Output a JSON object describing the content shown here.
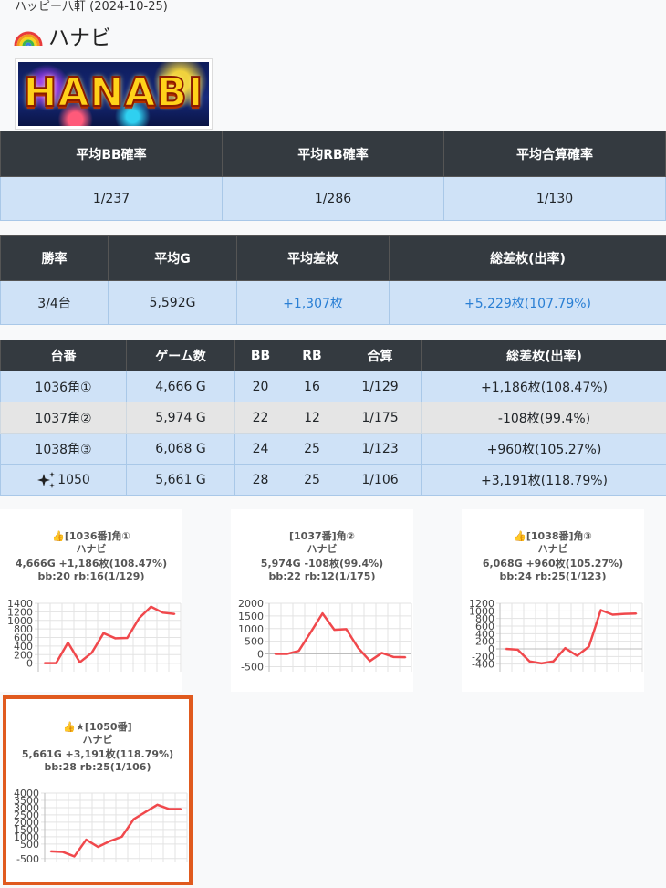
{
  "header": {
    "store_date": "ハッピー八軒 (2024-10-25)",
    "title": "ハナビ",
    "banner_text": "HANABI"
  },
  "summary1": {
    "headers": [
      "平均BB確率",
      "平均RB確率",
      "平均合算確率"
    ],
    "values": [
      "1/237",
      "1/286",
      "1/130"
    ]
  },
  "summary2": {
    "headers": [
      "勝率",
      "平均G",
      "平均差枚",
      "総差枚(出率)"
    ],
    "values": [
      "3/4台",
      "5,592G",
      "+1,307枚",
      "+5,229枚(107.79%)"
    ]
  },
  "machines": {
    "headers": [
      "台番",
      "ゲーム数",
      "BB",
      "RB",
      "合算",
      "総差枚(出率)"
    ],
    "rows": [
      {
        "no": "1036角①",
        "games": "4,666 G",
        "bb": "20",
        "rb": "16",
        "total": "1/129",
        "diff": "+1,186枚(108.47%)"
      },
      {
        "no": "1037角②",
        "games": "5,974 G",
        "bb": "22",
        "rb": "12",
        "total": "1/175",
        "diff": "-108枚(99.4%)"
      },
      {
        "no": "1038角③",
        "games": "6,068 G",
        "bb": "24",
        "rb": "25",
        "total": "1/123",
        "diff": "+960枚(105.27%)"
      },
      {
        "no": "1050",
        "games": "5,661 G",
        "bb": "28",
        "rb": "25",
        "total": "1/106",
        "diff": "+3,191枚(118.79%)"
      }
    ]
  },
  "cards": [
    {
      "line1": "👍[1036番]角①",
      "line2": "ハナビ",
      "line3": "4,666G +1,186枚(108.47%)",
      "line4": "bb:20 rb:16(1/129)"
    },
    {
      "line1": "[1037番]角②",
      "line2": "ハナビ",
      "line3": "5,974G -108枚(99.4%)",
      "line4": "bb:22 rb:12(1/175)"
    },
    {
      "line1": "👍[1038番]角③",
      "line2": "ハナビ",
      "line3": "6,068G +960枚(105.27%)",
      "line4": "bb:24 rb:25(1/123)"
    },
    {
      "line1": "👍★[1050番]",
      "line2": "ハナビ",
      "line3": "5,661G +3,191枚(118.79%)",
      "line4": "bb:28 rb:25(1/106)"
    }
  ],
  "chart_data": [
    {
      "type": "line",
      "ylim": [
        -200,
        1400
      ],
      "yticks": [
        1400,
        1200,
        1000,
        800,
        600,
        400,
        200,
        0
      ],
      "values": [
        0,
        0,
        480,
        20,
        240,
        700,
        580,
        590,
        1050,
        1320,
        1180,
        1150
      ],
      "line_color": "#f0484c"
    },
    {
      "type": "line",
      "ylim": [
        -700,
        2000
      ],
      "yticks": [
        2000,
        1500,
        1000,
        500,
        0,
        -500
      ],
      "values": [
        0,
        0,
        120,
        850,
        1600,
        950,
        980,
        240,
        -280,
        40,
        -120,
        -130
      ],
      "line_color": "#f0484c"
    },
    {
      "type": "line",
      "ylim": [
        -600,
        1200
      ],
      "yticks": [
        1200,
        1000,
        800,
        600,
        400,
        200,
        0,
        -200,
        -400
      ],
      "values": [
        0,
        -20,
        -330,
        -380,
        -330,
        20,
        -180,
        60,
        1020,
        900,
        920,
        930
      ],
      "line_color": "#f0484c"
    },
    {
      "type": "line",
      "ylim": [
        -700,
        4000
      ],
      "yticks": [
        4000,
        3500,
        3000,
        2500,
        2000,
        1500,
        1000,
        500,
        -500
      ],
      "values": [
        0,
        -40,
        -350,
        800,
        300,
        700,
        1000,
        2200,
        2700,
        3200,
        2900,
        2900
      ],
      "line_color": "#f0484c"
    }
  ]
}
